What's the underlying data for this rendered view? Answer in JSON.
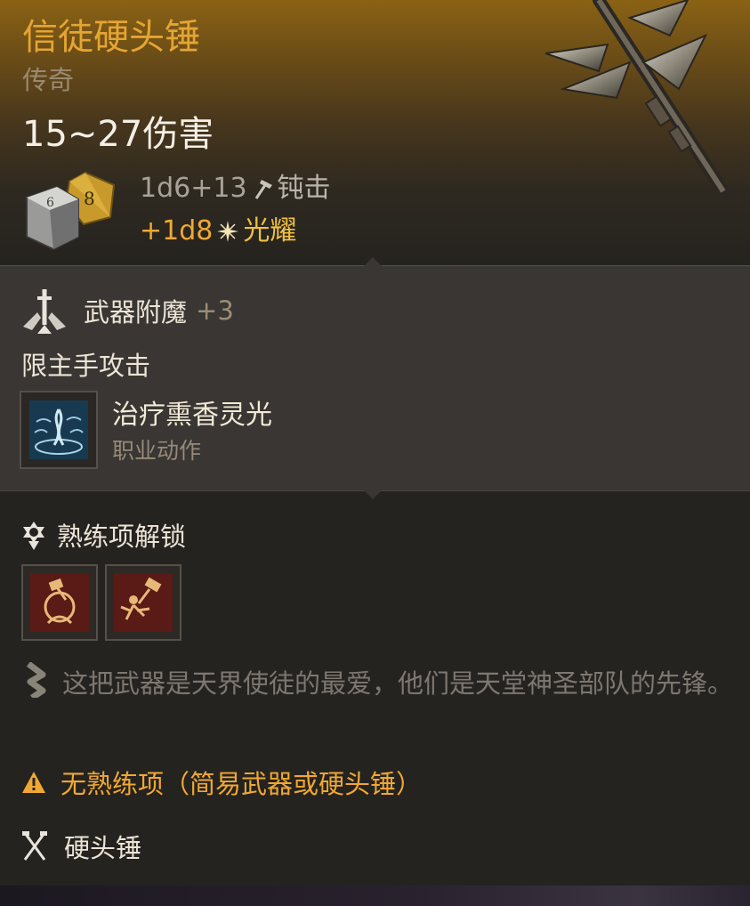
{
  "item": {
    "name": "信徒硬头锤",
    "rarity": "传奇",
    "damage_summary": "15~27伤害",
    "damage_lines": [
      {
        "dice": "1d6+13",
        "type": "钝击",
        "icon": "blunt-hammer-icon"
      },
      {
        "dice": "+1d8",
        "type": "光耀",
        "icon": "radiant-sparkle-icon"
      }
    ],
    "dice_faces": [
      "6",
      "8"
    ]
  },
  "enchantment": {
    "label": "武器附魔",
    "value": "+3",
    "icon": "weapon-enchant-icon"
  },
  "restriction": "限主手攻击",
  "action": {
    "name": "治疗熏香灵光",
    "category": "职业动作",
    "icon": "healing-aura-icon"
  },
  "proficiency": {
    "heading": "熟练项解锁",
    "icons": [
      "proficiency-portrait-icon",
      "proficiency-strike-icon"
    ]
  },
  "lore": "这把武器是天界使徒的最爱，他们是天堂神圣部队的先锋。",
  "warning": "无熟练项（简易武器或硬头锤）",
  "weapon_type": "硬头锤",
  "colors": {
    "legendary": "#e5a533",
    "warning": "#f0a832",
    "radiant": "#f0c040",
    "panel": "#393633",
    "background": "#252320"
  }
}
